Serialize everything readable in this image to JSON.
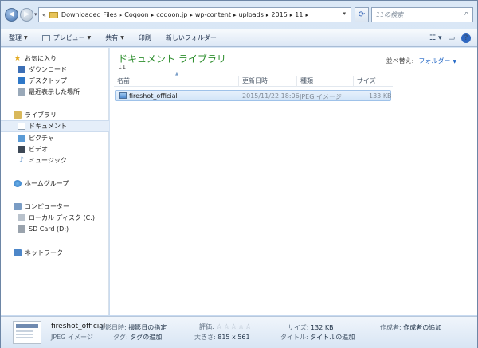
{
  "navigation": {
    "back_glyph": "◀",
    "forward_glyph": "▶",
    "breadcrumb_lead": "«",
    "breadcrumbs": [
      "Downloaded Files",
      "Coqoon",
      "coqoon.jp",
      "wp-content",
      "uploads",
      "2015",
      "11"
    ],
    "search_placeholder": "11の検索"
  },
  "toolbar": {
    "organize": "整理",
    "preview": "プレビュー",
    "share": "共有",
    "print": "印刷",
    "new_folder": "新しいフォルダー",
    "help": "?"
  },
  "sidebar": {
    "favorites": {
      "label": "お気に入り",
      "items": [
        "ダウンロード",
        "デスクトップ",
        "最近表示した場所"
      ]
    },
    "libraries": {
      "label": "ライブラリ",
      "items": [
        "ドキュメント",
        "ピクチャ",
        "ビデオ",
        "ミュージック"
      ],
      "selected": "ドキュメント"
    },
    "homegroup": "ホームグループ",
    "computer": {
      "label": "コンピューター",
      "items": [
        "ローカル ディスク (C:)",
        "SD Card (D:)"
      ]
    },
    "network": "ネットワーク"
  },
  "main": {
    "library_title": "ドキュメント ライブラリ",
    "library_subtitle": "11",
    "arrange_label": "並べ替え:",
    "arrange_value": "フォルダー",
    "columns": {
      "name": "名前",
      "date": "更新日時",
      "type": "種類",
      "size": "サイズ"
    },
    "files": [
      {
        "name": "fireshot_official",
        "date": "2015/11/22 18:06",
        "type": "JPEG イメージ",
        "size": "133 KB"
      }
    ]
  },
  "details": {
    "file_name": "fireshot_official",
    "file_type": "JPEG イメージ",
    "date_taken_label": "撮影日時:",
    "date_taken_value": "撮影日の指定",
    "tags_label": "タグ:",
    "tags_value": "タグの追加",
    "rating_label": "評価:",
    "rating_stars": "☆☆☆☆☆",
    "dimensions_label": "大きさ:",
    "dimensions_value": "815 x 561",
    "size_label": "サイズ:",
    "size_value": "132 KB",
    "title_label": "タイトル:",
    "title_value": "タイトルの追加",
    "author_label": "作成者:",
    "author_value": "作成者の追加"
  }
}
